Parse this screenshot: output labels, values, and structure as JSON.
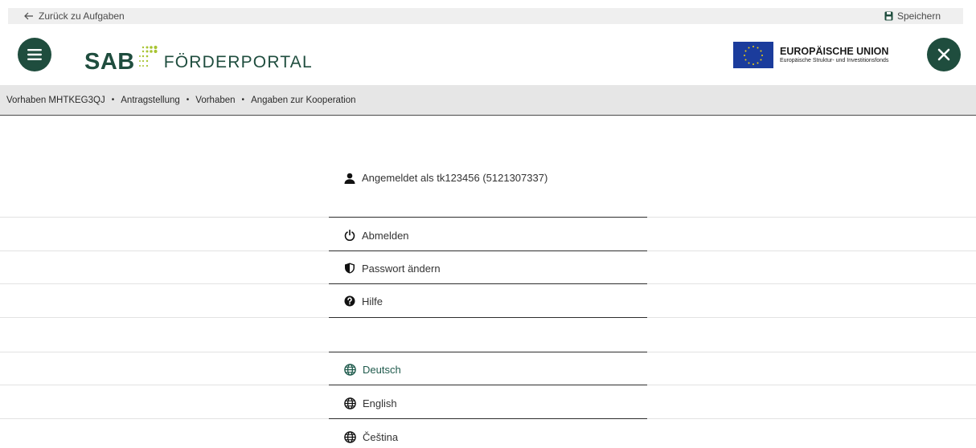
{
  "topbar": {
    "back_label": "Zurück zu Aufgaben",
    "save_label": "Speichern"
  },
  "header": {
    "logo_sab": "SAB",
    "logo_text": "FÖRDERPORTAL",
    "eu_title": "EUROPÄISCHE UNION",
    "eu_subtitle": "Europäische Struktur- und Investitionsfonds"
  },
  "breadcrumb": [
    "Vorhaben MHTKEG3QJ",
    "Antragstellung",
    "Vorhaben",
    "Angaben zur Kooperation"
  ],
  "breadcrumb_separator": "•",
  "user_menu": {
    "logged_in_label": "Angemeldet als tk123456 (5121307337)",
    "items": [
      {
        "label": "Abmelden",
        "icon": "power-icon"
      },
      {
        "label": "Passwort ändern",
        "icon": "shield-icon"
      },
      {
        "label": "Hilfe",
        "icon": "help-icon"
      }
    ],
    "languages": [
      {
        "label": "Deutsch",
        "icon": "globe-icon",
        "active": true
      },
      {
        "label": "English",
        "icon": "globe-icon",
        "active": false
      },
      {
        "label": "Čeština",
        "icon": "globe-icon",
        "active": false
      }
    ]
  },
  "colors": {
    "brand": "#1f4d3e",
    "accent_green": "#a8c433",
    "eu_blue": "#1b3c9c",
    "active_text": "#1f5a4c"
  }
}
